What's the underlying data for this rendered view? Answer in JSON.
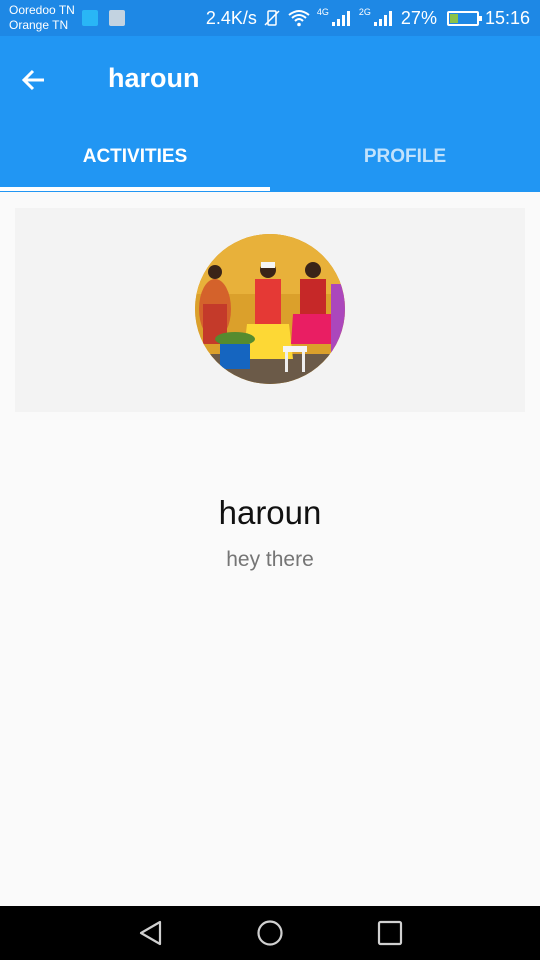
{
  "status_bar": {
    "carrier_1": "Ooredoo TN",
    "carrier_2": "Orange TN",
    "speed": "2.4K/s",
    "net_1": "4G",
    "net_2": "2G",
    "battery": "27%",
    "battery_level": 0.27,
    "time": "15:16"
  },
  "app_bar": {
    "title": "haroun",
    "back_icon": "arrow-back-icon",
    "tabs": [
      {
        "label": "ACTIVITIES",
        "active": true
      },
      {
        "label": "PROFILE",
        "active": false
      }
    ]
  },
  "profile": {
    "name": "haroun",
    "status": "hey there"
  },
  "colors": {
    "primary": "#2196f3",
    "status_bar": "#1e88e5",
    "background": "#fafafa"
  },
  "nav_bar": {
    "icons": [
      "back-triangle-icon",
      "home-circle-icon",
      "recents-square-icon"
    ]
  }
}
